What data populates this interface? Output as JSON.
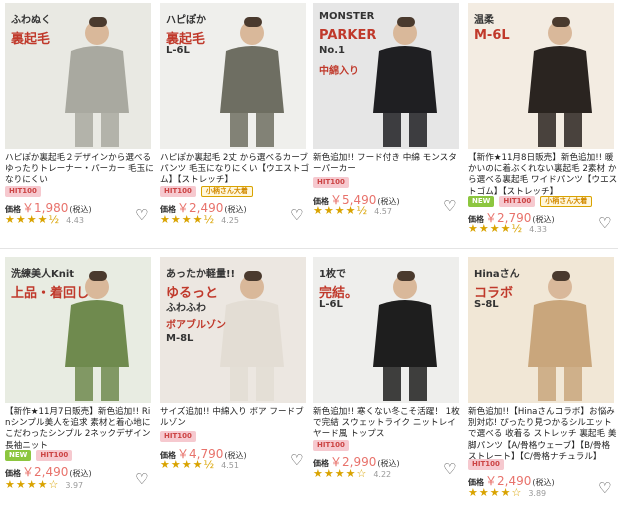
{
  "products": [
    {
      "title": "ハピぽか裏起毛２デザインから選べるゆったりトレーナー・パーカー 毛玉になりにくい",
      "badges": [
        {
          "label": "HIT100",
          "kind": "hit"
        }
      ],
      "price_label": "価格",
      "price": "￥1,980",
      "tax": "(税込)",
      "stars": "★★★★½",
      "rating": "4.43",
      "thumb_text": [
        "ふわぬく",
        "裏起毛"
      ],
      "bg": "#e9e9e3"
    },
    {
      "title": "ハピぽか裏起毛 2丈 から選べるカーブパンツ 毛玉になりにくい【ウエストゴム】【ストレッチ】",
      "badges": [
        {
          "label": "HIT100",
          "kind": "hit"
        },
        {
          "label": "小柄さん大着",
          "kind": "size"
        }
      ],
      "price_label": "価格",
      "price": "￥2,490",
      "tax": "(税込)",
      "stars": "★★★★½",
      "rating": "4.25",
      "thumb_text": [
        "ハピぽか",
        "裏起毛",
        "L-6L"
      ],
      "bg": "#efefec"
    },
    {
      "title": "新色追加!! フード付き 中綿 モンスターパーカー",
      "badges": [
        {
          "label": "HIT100",
          "kind": "hit"
        }
      ],
      "price_label": "価格",
      "price": "￥5,490",
      "tax": "(税込)",
      "stars": "★★★★½",
      "rating": "4.57",
      "thumb_text": [
        "MONSTER",
        "PARKER",
        "No.1",
        "中綿入り"
      ],
      "bg": "#e6e6e6"
    },
    {
      "title": "【新作★11月8日販売】新色追加!! 暖かいのに着ぶくれない裏起毛 2素材 から選べる裏起毛 ワイドパンツ【ウエストゴム】【ストレッチ】",
      "badges": [
        {
          "label": "NEW",
          "kind": "new"
        },
        {
          "label": "HIT100",
          "kind": "hit"
        },
        {
          "label": "小柄さん大着",
          "kind": "size"
        }
      ],
      "price_label": "価格",
      "price": "￥2,790",
      "tax": "(税込)",
      "stars": "★★★★½",
      "rating": "4.33",
      "thumb_text": [
        "温柔",
        "M-6L"
      ],
      "bg": "#f3ece2"
    },
    {
      "title": "【新作★11月7日販売】新色追加!! Rinシンプル美人を追求 素材と着心地にこだわったシンプル 2ネックデザイン 長袖ニット",
      "badges": [
        {
          "label": "NEW",
          "kind": "new"
        },
        {
          "label": "HIT100",
          "kind": "hit"
        }
      ],
      "price_label": "価格",
      "price": "￥2,490",
      "tax": "(税込)",
      "stars": "★★★★☆",
      "rating": "3.97",
      "thumb_text": [
        "洗練美人Knit",
        "上品・着回し"
      ],
      "bg": "#e8ece2"
    },
    {
      "title": "サイズ追加!! 中綿入り ボア フードブルゾン",
      "badges": [
        {
          "label": "HIT100",
          "kind": "hit"
        }
      ],
      "price_label": "価格",
      "price": "￥4,790",
      "tax": "(税込)",
      "stars": "★★★★½",
      "rating": "4.51",
      "thumb_text": [
        "あったか軽量!!",
        "ゆるっと",
        "ふわふわ",
        "ボアブルゾン",
        "M-8L"
      ],
      "bg": "#ece7e1"
    },
    {
      "title": "新色追加!! 寒くない冬こそ活躍！ 1枚で完結 スウェットライク ニットレイヤード風 トップス",
      "badges": [
        {
          "label": "HIT100",
          "kind": "hit"
        }
      ],
      "price_label": "価格",
      "price": "￥2,990",
      "tax": "(税込)",
      "stars": "★★★★☆",
      "rating": "4.22",
      "thumb_text": [
        "1枚で",
        "完結。",
        "L-6L"
      ],
      "bg": "#eeeeec"
    },
    {
      "title": "新色追加!!【Hinaさんコラボ】お悩み別対応! ぴったり見つかるシルエットで選べる 收着る ストレッチ 裏起毛 美脚パンツ【A/骨格ウェーブ】【B/骨格ストレート】【C/骨格ナチュラル】",
      "badges": [
        {
          "label": "HIT100",
          "kind": "hit"
        }
      ],
      "price_label": "価格",
      "price": "￥2,490",
      "tax": "(税込)",
      "stars": "★★★★☆",
      "rating": "3.89",
      "thumb_text": [
        "Hinaさん",
        "コラボ",
        "S-8L"
      ],
      "bg": "#f1e7d6"
    }
  ]
}
